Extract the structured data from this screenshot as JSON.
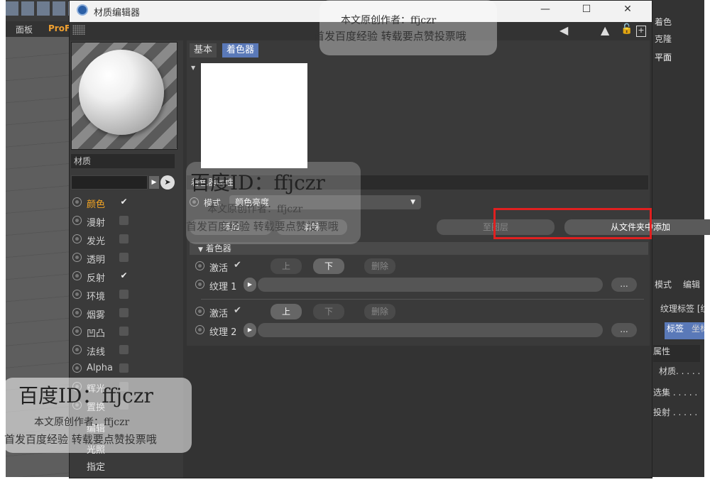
{
  "background_app": {
    "menu": [
      "面板",
      "ProF"
    ],
    "right_panel": {
      "top_items": [
        "着色",
        "克隆",
        "平面"
      ],
      "bottom_items": [
        "模式",
        "编辑",
        "纹理标签 [纹",
        "标签",
        "坐标",
        "属性",
        "材质. . . . .",
        "选集 . . . . .",
        "投射 . . . . ."
      ]
    }
  },
  "window": {
    "title": "材质编辑器",
    "minimize": "—",
    "maximize": "☐",
    "close": "✕"
  },
  "left_panel": {
    "material_name": "材质",
    "channels": [
      {
        "label": "颜色",
        "checked": true,
        "active": true
      },
      {
        "label": "漫射",
        "checked": false
      },
      {
        "label": "发光",
        "checked": false
      },
      {
        "label": "透明",
        "checked": false
      },
      {
        "label": "反射",
        "checked": true
      },
      {
        "label": "环境",
        "checked": false
      },
      {
        "label": "烟雾",
        "checked": false
      },
      {
        "label": "凹凸",
        "checked": false
      },
      {
        "label": "法线",
        "checked": false
      },
      {
        "label": "Alpha",
        "checked": false
      },
      {
        "label": "辉光",
        "checked": false
      },
      {
        "label": "置换",
        "checked": false
      }
    ],
    "footer": [
      "编辑",
      "光照",
      "指定"
    ]
  },
  "content": {
    "tabs": [
      "基本",
      "着色器"
    ],
    "selected_tab": "着色器",
    "section_title": "着色器属性",
    "mode_label": "模式",
    "mode_value": "颜色亮度",
    "buttons": [
      "添加",
      "清除",
      "至图层",
      "从文件夹中添加"
    ],
    "subsection": "着色器",
    "layers": [
      {
        "active_label": "激活",
        "up": "上",
        "down": "下",
        "delete": "删除",
        "texture_label": "纹理 1",
        "browse": "..."
      },
      {
        "active_label": "激活",
        "up": "上",
        "down": "下",
        "delete": "删除",
        "texture_label": "纹理 2",
        "browse": "..."
      }
    ]
  },
  "watermarks": {
    "brand": "百度ID：ffjczr",
    "line1": "本文原创作者：ffjczr",
    "line2": "首发百度经验 转载要点赞投票哦"
  },
  "colors": {
    "accent_tab": "#5a79b8",
    "active_channel": "#f5a623",
    "highlight_box": "#e02020"
  }
}
